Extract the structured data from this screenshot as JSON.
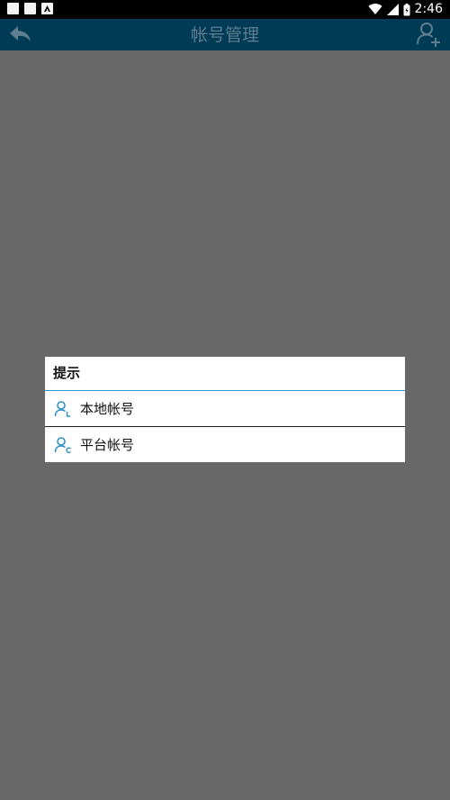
{
  "status_bar": {
    "time": "2:46",
    "icons": [
      "notification-square-icon",
      "notification-square-icon",
      "notification-a-icon",
      "wifi-icon",
      "signal-icon",
      "battery-icon"
    ]
  },
  "app_bar": {
    "title": "帐号管理",
    "back_icon": "back-arrow-icon",
    "add_icon": "add-user-icon",
    "background": "#003b55"
  },
  "dialog": {
    "title": "提示",
    "accent": "#2a9ad4",
    "options": [
      {
        "label": "本地帐号",
        "icon": "user-local-icon",
        "icon_letter": "L"
      },
      {
        "label": "平台帐号",
        "icon": "user-cloud-icon",
        "icon_letter": "c"
      }
    ]
  }
}
